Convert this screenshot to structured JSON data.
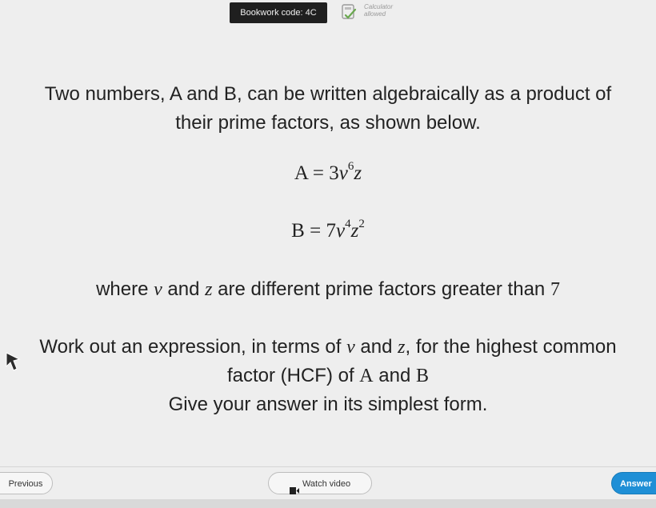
{
  "header": {
    "bookwork_code": "Bookwork code: 4C",
    "calculator_line1": "Calculator",
    "calculator_line2": "allowed"
  },
  "question": {
    "intro_line1": "Two numbers, A and B, can be written algebraically as a product of",
    "intro_line2": "their prime factors, as shown below.",
    "eq_a": {
      "lhs": "A",
      "equals": "=",
      "coef": "3",
      "var1": "v",
      "exp1": "6",
      "var2": "z"
    },
    "eq_b": {
      "lhs": "B",
      "equals": "=",
      "coef": "7",
      "var1": "v",
      "exp1": "4",
      "var2": "z",
      "exp2": "2"
    },
    "where": {
      "prefix": "where ",
      "var_v": "v",
      "and": " and ",
      "var_z": "z",
      "suffix": " are different prime factors greater than ",
      "number": "7"
    },
    "task": {
      "part1": "Work out an expression, in terms of ",
      "var_v": "v",
      "and": " and ",
      "var_z": "z",
      "part2": ", for the highest common",
      "line2_prefix": "factor (HCF) of ",
      "a": "A",
      "line2_and": " and ",
      "b": "B",
      "line3": "Give your answer in its simplest form."
    }
  },
  "footer": {
    "previous_label": "Previous",
    "watch_label": "Watch video",
    "answer_label": "Answer"
  },
  "colors": {
    "background": "#eeeeee",
    "badge": "#1f1f1f",
    "answer_button": "#1f8fd6"
  },
  "icons": {
    "calculator": "calculator-check-icon",
    "pointer": "pointer-cursor-icon",
    "video": "video-icon"
  }
}
